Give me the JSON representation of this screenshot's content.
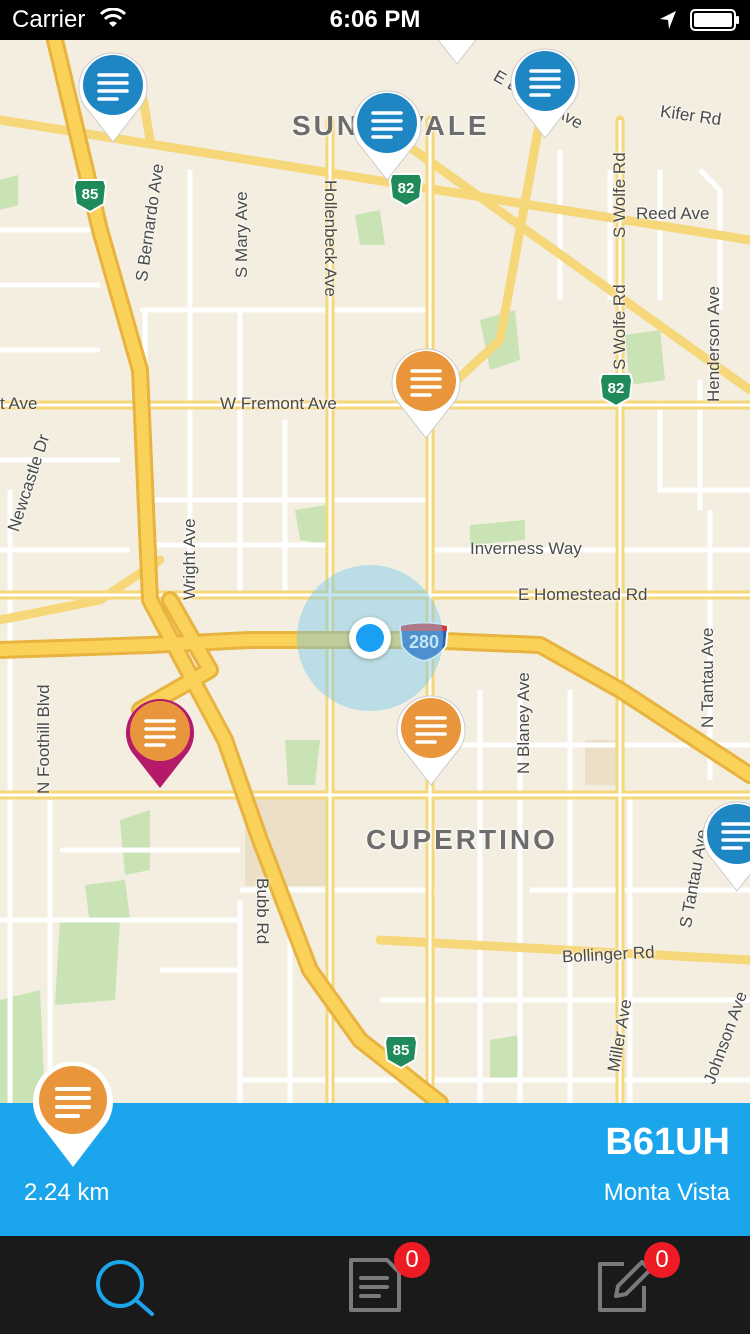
{
  "status_bar": {
    "carrier": "Carrier",
    "time": "6:06 PM"
  },
  "map": {
    "city_labels": {
      "sunnyvale": "SUNNYVALE",
      "cupertino": "CUPERTINO"
    },
    "streets": {
      "kifer": "Kifer Rd",
      "reed": "Reed Ave",
      "e_evelyn": "E Evelyn Ave",
      "s_bernardo": "S Bernardo Ave",
      "s_mary": "S Mary Ave",
      "hollenbeck": "Hollenbeck Ave",
      "s_wolfe_1": "S Wolfe Rd",
      "s_wolfe_2": "S Wolfe Rd",
      "henderson": "Henderson Ave",
      "w_fremont": "W Fremont Ave",
      "fremont_left": "t Ave",
      "newcastle": "Newcastle Dr",
      "inverness": "Inverness Way",
      "e_homestead": "E Homestead Rd",
      "wright": "Wright Ave",
      "n_foothill": "N Foothill Blvd",
      "n_blaney": "N Blaney Ave",
      "n_tantau": "N Tantau Ave",
      "s_tantau": "S Tantau Ave",
      "bollinger": "Bollinger Rd",
      "bubb": "Bubb Rd",
      "miller": "Miller Ave",
      "johnson": "Johnson Ave"
    },
    "shields": {
      "hwy85_top": "85",
      "hwy82_top": "82",
      "hwy82_right": "82",
      "i280": "280",
      "hwy85_bottom": "85"
    },
    "colors": {
      "pin_blue": "#1f86c4",
      "pin_orange": "#e8953b",
      "pin_selected": "#b5196a"
    }
  },
  "info_panel": {
    "distance": "2.24 km",
    "code": "B61UH",
    "place": "Monta Vista"
  },
  "tab_bar": {
    "tabs": [
      {
        "name": "search",
        "icon": "search-icon",
        "badge": ""
      },
      {
        "name": "notes",
        "icon": "document-icon",
        "badge": "0"
      },
      {
        "name": "compose",
        "icon": "edit-icon",
        "badge": "0"
      }
    ],
    "active_color": "#1ba5ec"
  }
}
